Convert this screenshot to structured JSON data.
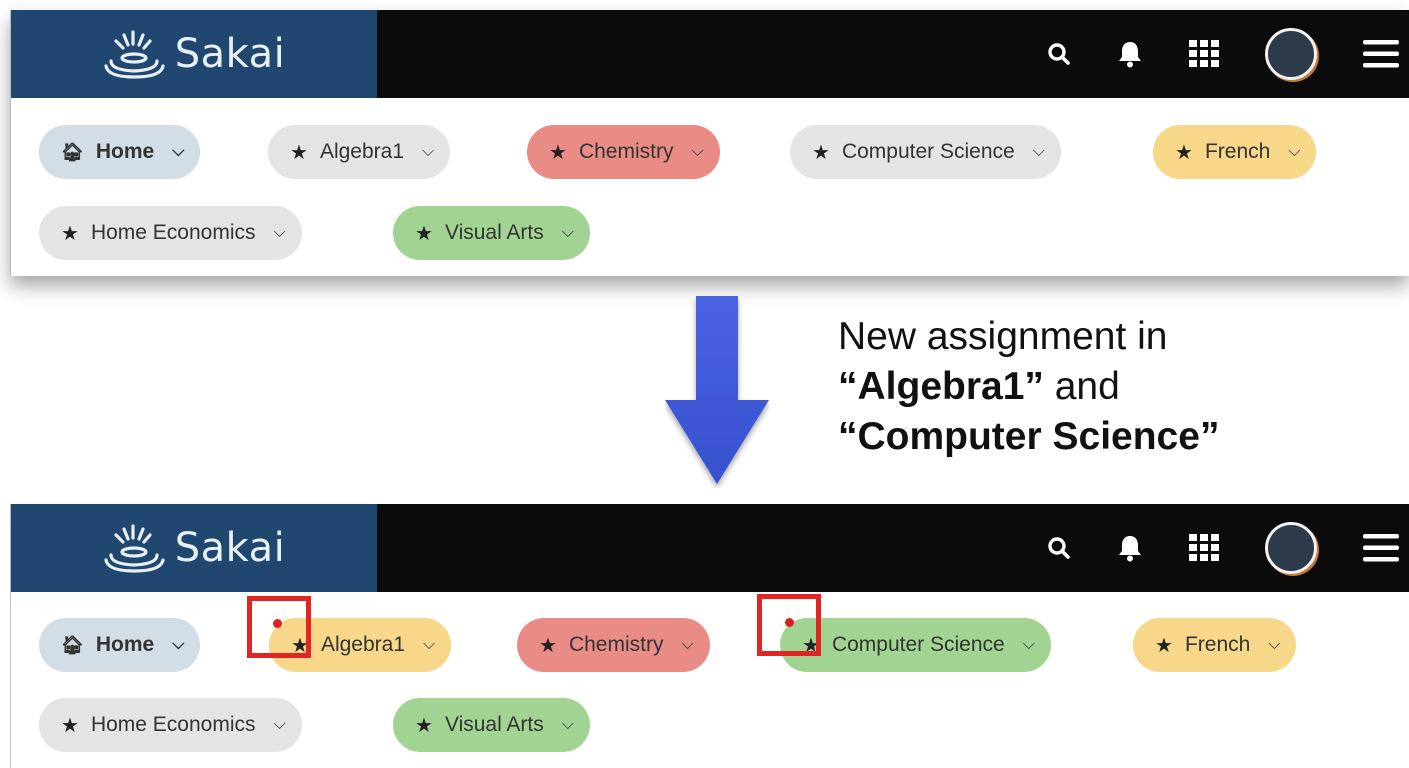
{
  "app": {
    "name": "Sakai"
  },
  "colors": {
    "header_bg": "#0b0b0b",
    "logo_bg": "#1f4770",
    "home_pill": "#d3dde6",
    "gray_pill": "#e4e4e4",
    "red_pill": "#ea8c86",
    "yellow_pill": "#f7d88a",
    "green_pill": "#a1d493",
    "highlight": "#e12424",
    "arrow": "#3e5ad8"
  },
  "icons": [
    "search-icon",
    "bell-icon",
    "grid-apps-icon",
    "avatar",
    "hamburger-menu-icon",
    "home-icon",
    "star-icon",
    "chevron-down-icon"
  ],
  "before": {
    "sites": [
      {
        "label": "Home",
        "color": "home",
        "icon": "home-icon"
      },
      {
        "label": "Algebra1",
        "color": "gray"
      },
      {
        "label": "Chemistry",
        "color": "red"
      },
      {
        "label": "Computer Science",
        "color": "gray"
      },
      {
        "label": "French",
        "color": "yellow"
      },
      {
        "label": "Home Economics",
        "color": "gray"
      },
      {
        "label": "Visual Arts",
        "color": "green"
      }
    ]
  },
  "after": {
    "sites": [
      {
        "label": "Home",
        "color": "home",
        "icon": "home-icon"
      },
      {
        "label": "Algebra1",
        "color": "yellow",
        "notification": true
      },
      {
        "label": "Chemistry",
        "color": "red"
      },
      {
        "label": "Computer Science",
        "color": "green",
        "notification": true
      },
      {
        "label": "French",
        "color": "yellow"
      },
      {
        "label": "Home Economics",
        "color": "gray"
      },
      {
        "label": "Visual Arts",
        "color": "green"
      }
    ]
  },
  "caption": {
    "line1": "New assignment in",
    "q1_open": "“",
    "q1_name": "Algebra1",
    "q1_close": "”",
    "and": " and",
    "q2_open": "“",
    "q2_name": "Computer Science",
    "q2_close": "”"
  }
}
